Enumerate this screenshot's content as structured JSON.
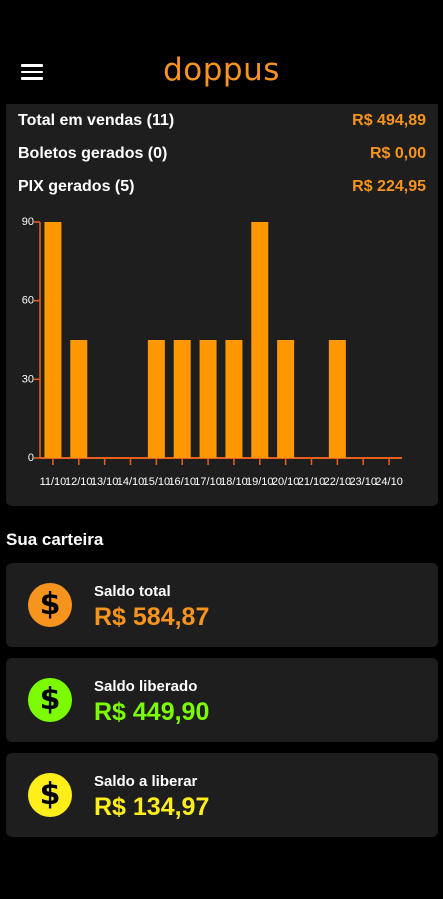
{
  "header": {
    "logo": "doppus",
    "menu_icon": "hamburger-menu-icon"
  },
  "sales": {
    "rows": [
      {
        "label": "Total em vendas (11)",
        "value": "R$ 494,89"
      },
      {
        "label": "Boletos gerados (0)",
        "value": "R$ 0,00"
      },
      {
        "label": "PIX gerados (5)",
        "value": "R$ 224,95"
      }
    ]
  },
  "colors": {
    "accent": "#f7941d",
    "bar": "#ff9800",
    "axis": "#e8601c",
    "green": "#7cfc00",
    "yellow": "#ffee1a",
    "card": "#1e1e1e"
  },
  "chart_data": {
    "type": "bar",
    "categories": [
      "11/10",
      "12/10",
      "13/10",
      "14/10",
      "15/10",
      "16/10",
      "17/10",
      "18/10",
      "19/10",
      "20/10",
      "21/10",
      "22/10",
      "23/10",
      "24/10"
    ],
    "values": [
      90,
      45,
      0,
      0,
      45,
      45,
      45,
      45,
      90,
      45,
      0,
      45,
      0,
      0
    ],
    "yticks": [
      0,
      30,
      60,
      90
    ],
    "ylim": [
      0,
      90
    ],
    "title": "",
    "xlabel": "",
    "ylabel": "",
    "grid": false
  },
  "wallet": {
    "title": "Sua carteira",
    "cards": [
      {
        "label": "Saldo total",
        "value": "R$ 584,87",
        "color": "#f7941d",
        "icon": "dollar-coin-icon"
      },
      {
        "label": "Saldo liberado",
        "value": "R$ 449,90",
        "color": "#7cfc00",
        "icon": "dollar-coin-icon"
      },
      {
        "label": "Saldo a liberar",
        "value": "R$ 134,97",
        "color": "#ffee1a",
        "icon": "dollar-coin-icon"
      }
    ]
  }
}
